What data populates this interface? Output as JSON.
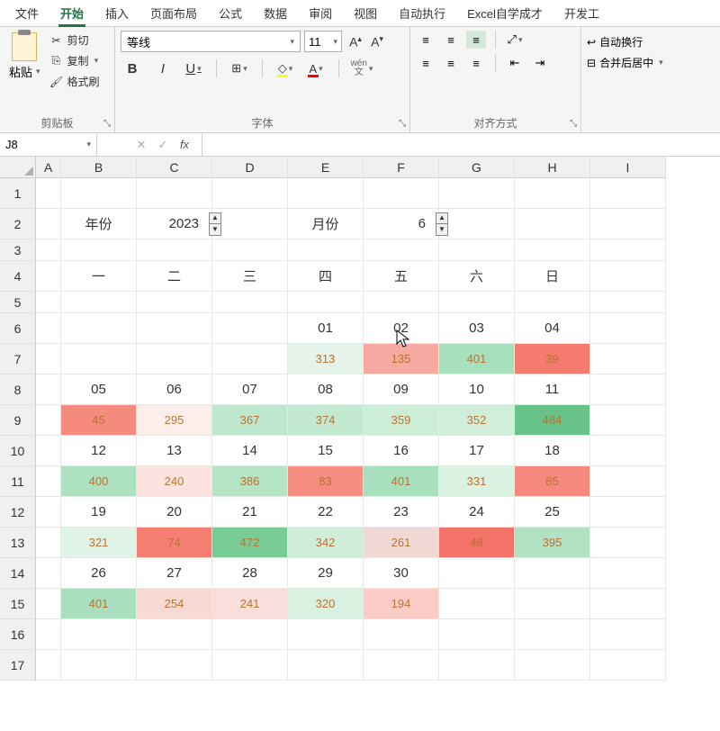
{
  "tabs": {
    "file": "文件",
    "home": "开始",
    "insert": "插入",
    "layout": "页面布局",
    "formula": "公式",
    "data": "数据",
    "review": "审阅",
    "view": "视图",
    "auto": "自动执行",
    "custom": "Excel自学成才",
    "dev": "开发工"
  },
  "ribbon": {
    "clipboard": {
      "paste": "粘贴",
      "cut": "剪切",
      "copy": "复制",
      "format": "格式刷",
      "label": "剪贴板"
    },
    "font": {
      "name": "等线",
      "size": "11",
      "label": "字体",
      "bold": "B",
      "italic": "I",
      "under": "U"
    },
    "align": {
      "label": "对齐方式",
      "wen": "wén",
      "wenzi": "文"
    },
    "wrap": {
      "wrap": "自动换行",
      "merge": "合并后居中"
    }
  },
  "namebox": "J8",
  "fx": "fx",
  "cols": [
    "A",
    "B",
    "C",
    "D",
    "E",
    "F",
    "G",
    "H",
    "I"
  ],
  "rows": [
    "1",
    "2",
    "3",
    "4",
    "5",
    "6",
    "7",
    "8",
    "9",
    "10",
    "11",
    "12",
    "13",
    "14",
    "15",
    "16",
    "17"
  ],
  "sheet": {
    "yearLabel": "年份",
    "year": "2023",
    "monthLabel": "月份",
    "month": "6",
    "dow": [
      "一",
      "二",
      "三",
      "四",
      "五",
      "六",
      "日"
    ],
    "days": [
      [
        "",
        "",
        "",
        "01",
        "02",
        "03",
        "04"
      ],
      [
        "05",
        "06",
        "07",
        "08",
        "09",
        "10",
        "11"
      ],
      [
        "12",
        "13",
        "14",
        "15",
        "16",
        "17",
        "18"
      ],
      [
        "19",
        "20",
        "21",
        "22",
        "23",
        "24",
        "25"
      ],
      [
        "26",
        "27",
        "28",
        "29",
        "30",
        "",
        ""
      ]
    ],
    "vals": [
      [
        "",
        "",
        "",
        "313",
        "135",
        "401",
        "39"
      ],
      [
        "45",
        "295",
        "367",
        "374",
        "359",
        "352",
        "484"
      ],
      [
        "400",
        "240",
        "386",
        "83",
        "401",
        "331",
        "85"
      ],
      [
        "321",
        "74",
        "472",
        "342",
        "261",
        "48",
        "395"
      ],
      [
        "401",
        "254",
        "241",
        "320",
        "194",
        "",
        ""
      ]
    ],
    "colors": [
      [
        "",
        "",
        "",
        "#e5f3ea",
        "#f6a9a0",
        "#a8dfbd",
        "#f47b6e"
      ],
      [
        "#f58b7f",
        "#fdeeec",
        "#bee8cd",
        "#c4e9d1",
        "#cceed7",
        "#d0eeda",
        "#67c387"
      ],
      [
        "#aee1c1",
        "#fce3df",
        "#b4e3c6",
        "#f58d81",
        "#a8dfbd",
        "#dbf1e2",
        "#f5897d"
      ],
      [
        "#dff3e6",
        "#f57e72",
        "#79cb96",
        "#cfedd9",
        "#f0d9d4",
        "#f47368",
        "#b1e2c3"
      ],
      [
        "#a9dfbe",
        "#f8dad5",
        "#fadedb",
        "#d9f1e1",
        "#fbccc5",
        "",
        ""
      ]
    ]
  }
}
